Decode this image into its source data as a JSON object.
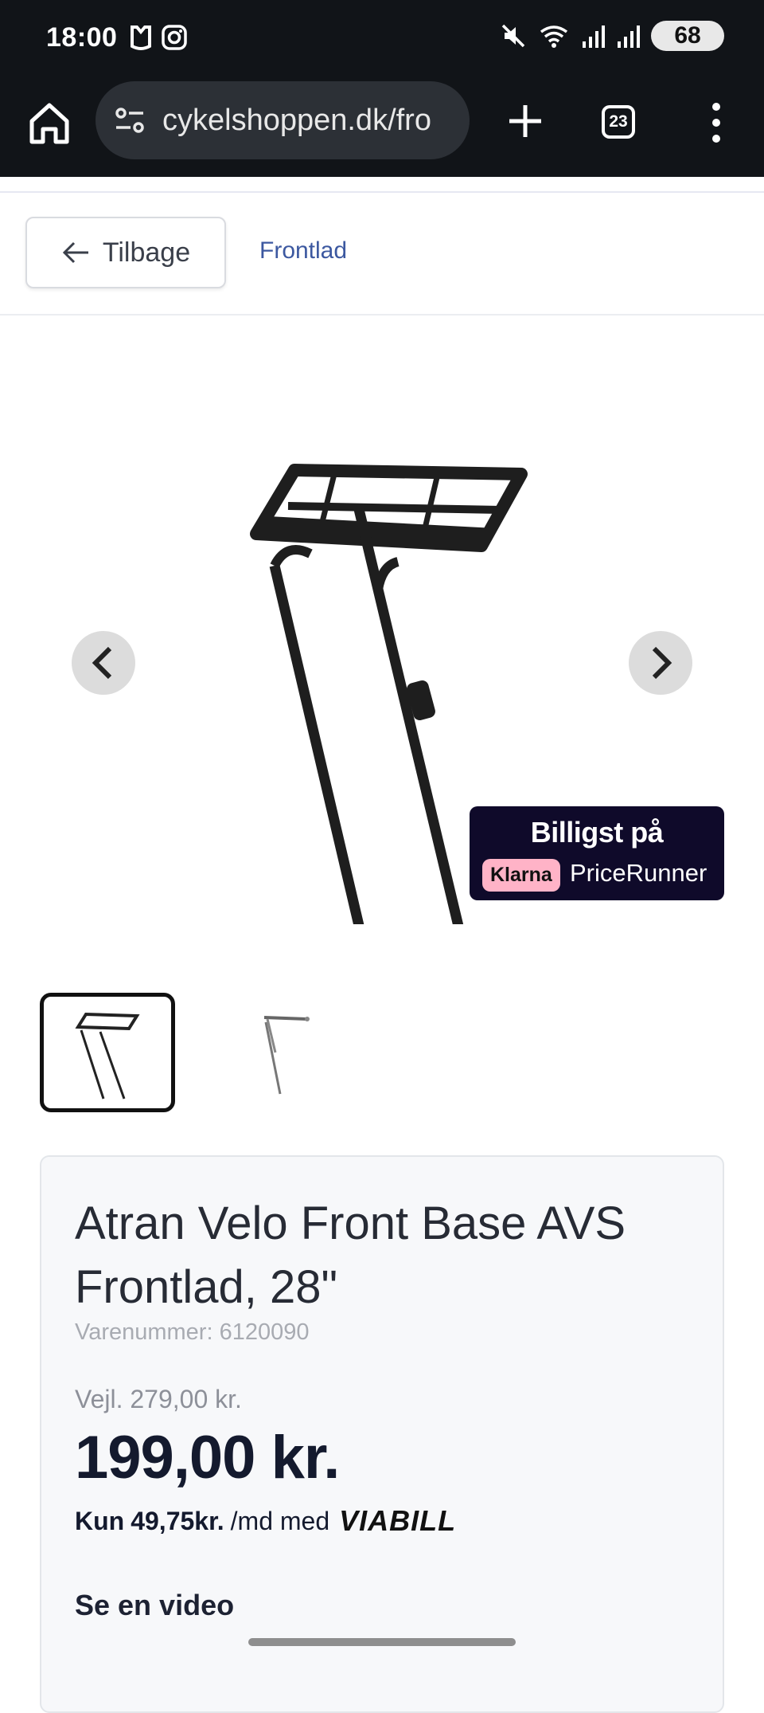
{
  "status_bar": {
    "time": "18:00",
    "battery": "68"
  },
  "browser": {
    "url": "cykelshoppen.dk/fro",
    "tab_count": "23"
  },
  "nav": {
    "back_label": "Tilbage",
    "breadcrumb": "Frontlad"
  },
  "pricerunner": {
    "headline": "Billigst på",
    "klarna": "Klarna",
    "name": "PriceRunner"
  },
  "product": {
    "title": "Atran Velo Front Base AVS Frontlad, 28\"",
    "sku": "Varenummer: 6120090",
    "rrp": "Vejl. 279,00 kr.",
    "price": "199,00 kr.",
    "installment_prefix": "Kun",
    "installment_amount": "49,75kr.",
    "installment_suffix": "/md med",
    "installment_provider": "VIABILL",
    "video_link": "Se en video"
  }
}
